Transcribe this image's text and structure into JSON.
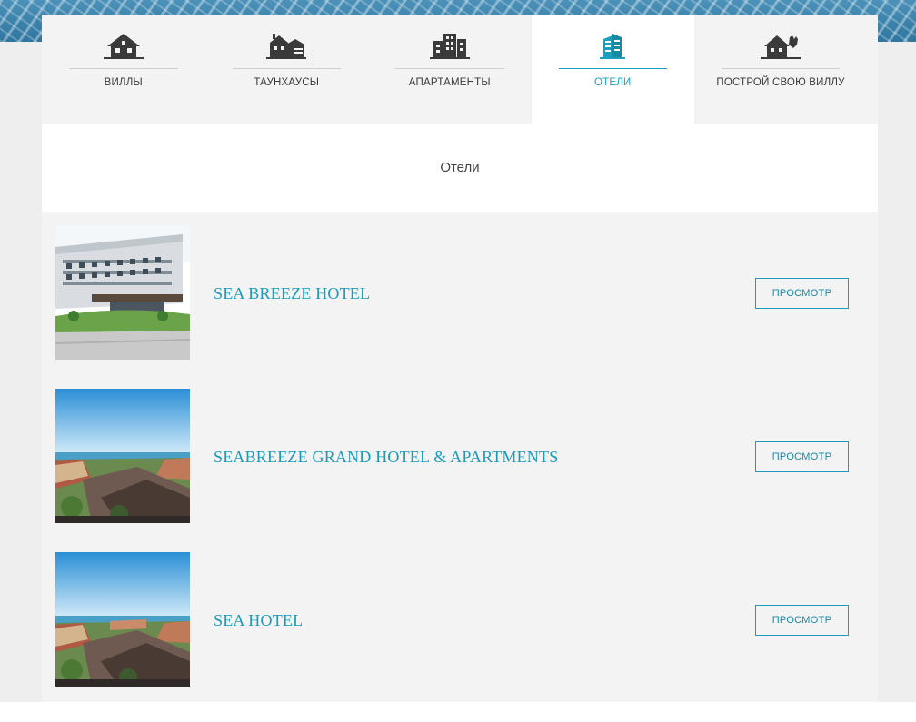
{
  "tabs": [
    {
      "label": "ВИЛЛЫ",
      "icon": "house-icon",
      "active": false
    },
    {
      "label": "ТАУНХАУСЫ",
      "icon": "townhouse-icon",
      "active": false
    },
    {
      "label": "АПАРТАМЕНТЫ",
      "icon": "apartments-icon",
      "active": false
    },
    {
      "label": "ОТЕЛИ",
      "icon": "hotel-icon",
      "active": true
    },
    {
      "label": "ПОСТРОЙ СВОЮ ВИЛЛУ",
      "icon": "build-villa-icon",
      "active": false
    }
  ],
  "section": {
    "title": "Отели"
  },
  "items": [
    {
      "title": "SEA BREEZE HOTEL",
      "button": "ПРОСМОТР"
    },
    {
      "title": "SEABREEZE GRAND HOTEL & APARTMENTS",
      "button": "ПРОСМОТР"
    },
    {
      "title": "SEA HOTEL",
      "button": "ПРОСМОТР"
    }
  ],
  "colors": {
    "accent": "#1a9bb8",
    "icon_dark": "#3a3a3a",
    "panel_bg": "#f3f3f3"
  }
}
